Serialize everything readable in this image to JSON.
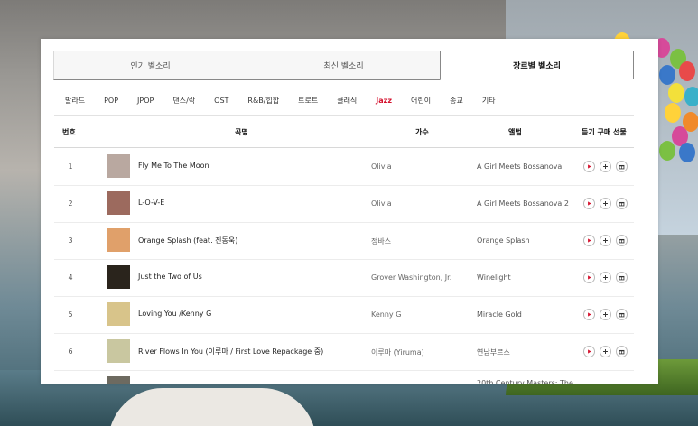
{
  "tabs": [
    {
      "label": "인기 벨소리",
      "active": false
    },
    {
      "label": "최신 벨소리",
      "active": false
    },
    {
      "label": "장르별 벨소리",
      "active": true
    }
  ],
  "genres": [
    {
      "label": "발라드",
      "active": false
    },
    {
      "label": "POP",
      "active": false
    },
    {
      "label": "JPOP",
      "active": false
    },
    {
      "label": "댄스/락",
      "active": false
    },
    {
      "label": "OST",
      "active": false
    },
    {
      "label": "R&B/힙합",
      "active": false
    },
    {
      "label": "트로트",
      "active": false
    },
    {
      "label": "클래식",
      "active": false
    },
    {
      "label": "Jazz",
      "active": true
    },
    {
      "label": "어린이",
      "active": false
    },
    {
      "label": "종교",
      "active": false
    },
    {
      "label": "기타",
      "active": false
    }
  ],
  "table": {
    "headers": {
      "num": "번호",
      "song": "곡명",
      "artist": "가수",
      "album": "앨범",
      "actions": "듣기 구매 선물"
    },
    "rows": [
      {
        "num": "1",
        "title": "Fly Me To The Moon",
        "artist": "Olivia",
        "album": "A Girl Meets Bossanova",
        "thumb_color": "#b9a8a0"
      },
      {
        "num": "2",
        "title": "L-O-V-E",
        "artist": "Olivia",
        "album": "A Girl Meets Bossanova 2",
        "thumb_color": "#9c6a5e"
      },
      {
        "num": "3",
        "title": "Orange Splash (feat. 진동욱)",
        "artist": "정바스",
        "album": "Orange Splash",
        "thumb_color": "#e0a06a"
      },
      {
        "num": "4",
        "title": "Just the Two of Us",
        "artist": "Grover Washington, Jr.",
        "album": "Winelight",
        "thumb_color": "#2a241c"
      },
      {
        "num": "5",
        "title": "Loving You /Kenny G",
        "artist": "Kenny G",
        "album": "Miracle Gold",
        "thumb_color": "#d8c48a"
      },
      {
        "num": "6",
        "title": "River Flows In You (이루마 / First Love Repackage 중)",
        "artist": "이루마 (Yiruma)",
        "album": "연남부르스",
        "thumb_color": "#c9c7a0"
      },
      {
        "num": "",
        "title": "",
        "artist": "",
        "album": "20th Century Masters: The",
        "thumb_color": "#6d6a60"
      }
    ]
  },
  "colors": {
    "accent": "#d4102c",
    "balloons": [
      "#ffd23a",
      "#f08a2c",
      "#d64a9a",
      "#7bc043",
      "#3a78c9",
      "#e84a4a",
      "#9a4ac9",
      "#f3e03a",
      "#3ab0c9"
    ]
  }
}
